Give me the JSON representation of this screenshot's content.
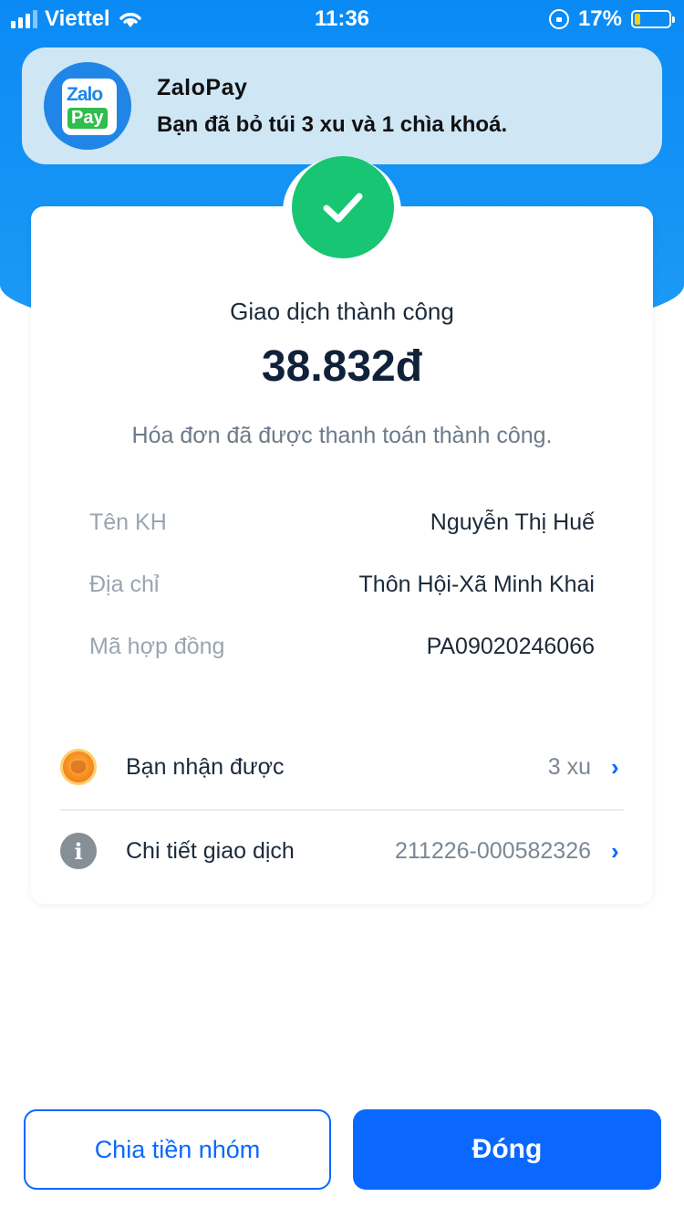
{
  "status_bar": {
    "carrier": "Viettel",
    "time": "11:36",
    "battery_percent": "17%",
    "battery_level": 0.17,
    "battery_color": "#ffd60a"
  },
  "notification": {
    "app_name": "ZaloPay",
    "message": "Bạn đã bỏ túi 3 xu và 1 chìa khoá.",
    "logo_text_top": "Zalo",
    "logo_text_bottom": "Pay"
  },
  "result": {
    "title": "Giao dịch thành công",
    "amount": "38.832đ",
    "description": "Hóa đơn đã được thanh toán thành công.",
    "status_icon": "check-icon",
    "status_color": "#18c572"
  },
  "details": [
    {
      "label": "Tên KH",
      "value": "Nguyễn Thị Huế"
    },
    {
      "label": "Địa chỉ",
      "value": "Thôn Hội-Xã Minh Khai"
    },
    {
      "label": "Mã hợp đồng",
      "value": "PA09020246066"
    }
  ],
  "rewards_row": {
    "icon": "coin-icon",
    "label": "Bạn nhận được",
    "value": "3 xu"
  },
  "transaction_row": {
    "icon": "info-icon",
    "label": "Chi tiết giao dịch",
    "value": "211226-000582326"
  },
  "buttons": {
    "split": "Chia tiền nhóm",
    "close": "Đóng"
  },
  "colors": {
    "primary": "#0a68ff",
    "header_blue": "#0a8af5"
  }
}
